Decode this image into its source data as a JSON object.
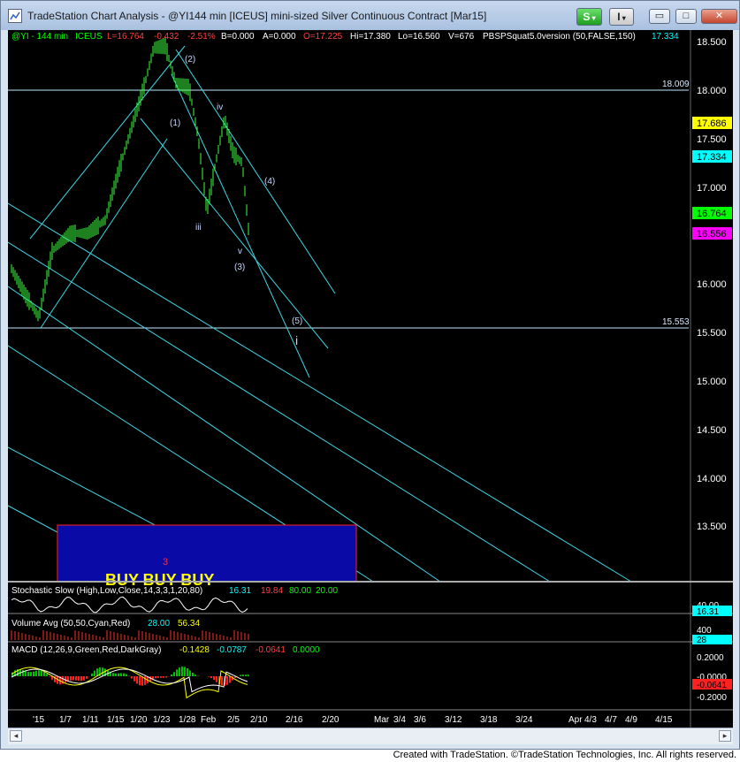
{
  "window": {
    "title": "TradeStation Chart Analysis - @YI144 min [ICEUS] mini-sized Silver Continuous Contract [Mar15]",
    "s_button": "S",
    "i_button": "I",
    "minimize": "▭",
    "maximize": "□",
    "close": "✕"
  },
  "header": {
    "symbol": "@YI - 144 min",
    "exchange": "ICEUS",
    "last": "L=16.764",
    "change": "-0.432",
    "change_pct": "-2.51%",
    "bid": "B=0.000",
    "ask": "A=0.000",
    "open": "O=17.225",
    "high": "Hi=17.380",
    "low": "Lo=16.560",
    "volume": "V=676",
    "indicator": "PBSPSquat5.0version (50,FALSE,150)",
    "ind_value": "17.334"
  },
  "price_axis": {
    "ticks": [
      "18.500",
      "18.000",
      "17.500",
      "17.000",
      "16.000",
      "15.500",
      "15.000",
      "14.500",
      "14.000",
      "13.500"
    ],
    "markers": [
      {
        "text": "17.686",
        "color": "#ffff00",
        "fg": "#000000"
      },
      {
        "text": "17.334",
        "color": "#00ffff",
        "fg": "#000000"
      },
      {
        "text": "16.764",
        "color": "#00ff00",
        "fg": "#000000"
      },
      {
        "text": "16.556",
        "color": "#ff00ff",
        "fg": "#000000"
      }
    ],
    "hline_labels": [
      "18.009",
      "15.553"
    ]
  },
  "wave_labels": [
    "(2)",
    "(1)",
    "iv",
    "iii",
    "(4)",
    "v",
    "(3)",
    "(5)",
    "i",
    "3"
  ],
  "buy_zone": {
    "text": "BUY BUY BUY",
    "fill": "#0a0aa6",
    "border": "#ff2020"
  },
  "stochastic": {
    "title": "Stochastic Slow (High,Low,Close,14,3,3,1,20,80)",
    "k": "16.31",
    "d": "19.84",
    "ob": "80.00",
    "os": "20.00",
    "axis_label": "16.31",
    "axis_ticks": [
      "40.00"
    ]
  },
  "volume_avg": {
    "title": "Volume Avg (50,50,Cyan,Red)",
    "v1": "28.00",
    "v2": "56.34",
    "axis_label": "28",
    "axis_ticks": [
      "400"
    ]
  },
  "macd": {
    "title": "MACD (12,26,9,Green,Red,DarkGray)",
    "v1": "-0.1428",
    "v2": "-0.0787",
    "v3": "-0.0641",
    "v4": "0.0000",
    "axis_ticks": [
      "0.2000",
      "-0.0000",
      "-0.2000"
    ],
    "axis_marker": "-0.0641"
  },
  "time_axis": [
    "'15",
    "1/7",
    "1/11",
    "1/15",
    "1/20",
    "1/23",
    "1/28",
    "Feb",
    "2/5",
    "2/10",
    "2/16",
    "2/20",
    "Mar",
    "3/4",
    "3/6",
    "3/12",
    "3/18",
    "3/24",
    "Apr",
    "4/3",
    "4/7",
    "4/9",
    "4/15"
  ],
  "footer": "Created with TradeStation. ©TradeStation Technologies, Inc. All rights reserved."
}
